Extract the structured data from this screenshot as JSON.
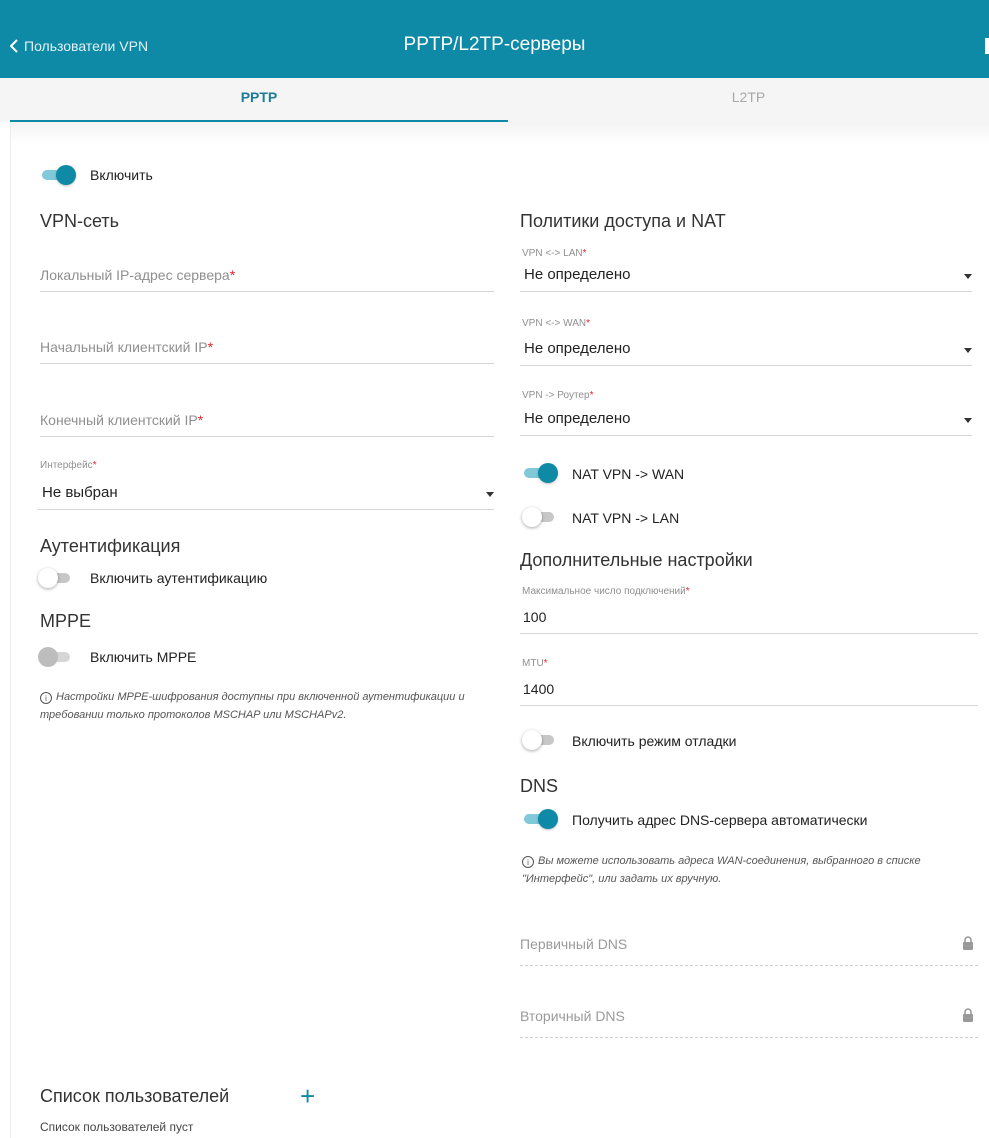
{
  "header": {
    "back_label": "Пользователи VPN",
    "title": "PPTP/L2TP-серверы"
  },
  "tabs": [
    {
      "label": "PPTP",
      "active": true
    },
    {
      "label": "L2TP",
      "active": false
    }
  ],
  "enable": {
    "label": "Включить",
    "on": true
  },
  "vpn_network": {
    "heading": "VPN-сеть",
    "local_ip_placeholder": "Локальный IP-адрес сервера",
    "start_ip_placeholder": "Начальный клиентский IP",
    "end_ip_placeholder": "Конечный клиентский IP",
    "interface_label": "Интерфейс",
    "interface_value": "Не выбран",
    "required_mark": "*"
  },
  "authentication": {
    "heading": "Аутентификация",
    "toggle_label": "Включить аутентификацию",
    "on": false
  },
  "mppe": {
    "heading": "MPPE",
    "toggle_label": "Включить MPPE",
    "on": false,
    "note_line1": "Настройки MPPE-шифрования доступны при включенной аутентификации и",
    "note_line2": "требовании только протоколов MSCHAP или MSCHAPv2."
  },
  "access_policy": {
    "heading": "Политики доступа и NAT",
    "vpn_lan_label": "VPN <-> LAN",
    "vpn_lan_value": "Не определено",
    "vpn_wan_label": "VPN <-> WAN",
    "vpn_wan_value": "Не определено",
    "vpn_router_label": "VPN -> Роутер",
    "vpn_router_value": "Не определено",
    "nat_wan_label": "NAT VPN -> WAN",
    "nat_wan_on": true,
    "nat_lan_label": "NAT VPN -> LAN",
    "nat_lan_on": false
  },
  "advanced": {
    "heading": "Дополнительные настройки",
    "max_conn_label": "Максимальное число подключений",
    "max_conn_value": "100",
    "mtu_label": "MTU",
    "mtu_value": "1400",
    "debug_label": "Включить режим отладки",
    "debug_on": false
  },
  "dns": {
    "heading": "DNS",
    "auto_label": "Получить адрес DNS-сервера автоматически",
    "auto_on": true,
    "note_line1": "Вы можете использовать адреса WAN-соединения, выбранного в списке",
    "note_line2": "\"Интерфейс\", или задать их вручную.",
    "primary_placeholder": "Первичный DNS",
    "secondary_placeholder": "Вторичный DNS"
  },
  "users": {
    "heading": "Список пользователей",
    "empty_text": "Список пользователей пуст",
    "add_symbol": "+"
  },
  "colors": {
    "accent": "#0e8aa6",
    "required": "#e1242a"
  }
}
